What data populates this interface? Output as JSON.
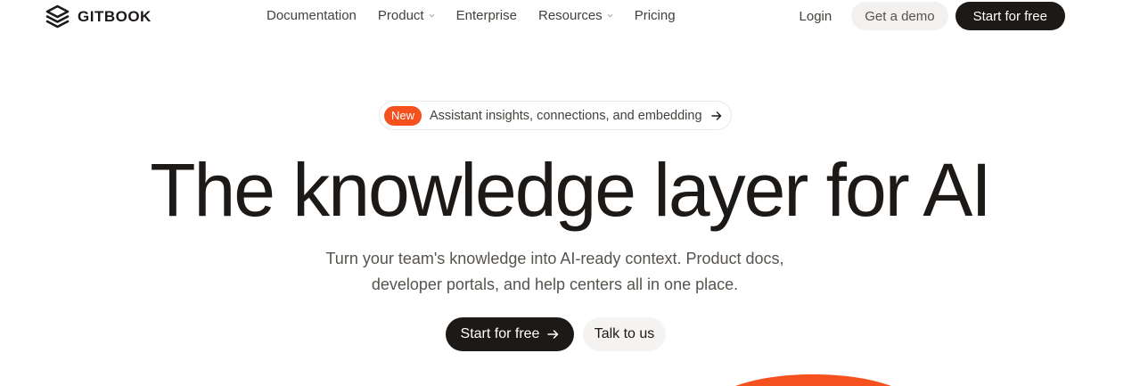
{
  "header": {
    "logo_text": "GITBOOK",
    "nav": [
      {
        "label": "Documentation",
        "has_dropdown": false
      },
      {
        "label": "Product",
        "has_dropdown": true
      },
      {
        "label": "Enterprise",
        "has_dropdown": false
      },
      {
        "label": "Resources",
        "has_dropdown": true
      },
      {
        "label": "Pricing",
        "has_dropdown": false
      }
    ],
    "login_label": "Login",
    "demo_label": "Get a demo",
    "start_label": "Start for free"
  },
  "announcement": {
    "badge": "New",
    "text": "Assistant insights, connections, and embedding",
    "badge_color": "#f4511e"
  },
  "hero": {
    "title": "The knowledge layer for AI",
    "subtitle_line1": "Turn your team's knowledge into AI-ready context. Product docs,",
    "subtitle_line2": "developer portals, and help centers all in one place.",
    "primary_label": "Start for free",
    "secondary_label": "Talk to us"
  },
  "colors": {
    "accent": "#f4511e",
    "dark": "#1c1917",
    "muted_bg": "#f2f1ef"
  },
  "icons": [
    "gitbook-logo-icon",
    "chevron-down-icon",
    "arrow-right-icon"
  ]
}
